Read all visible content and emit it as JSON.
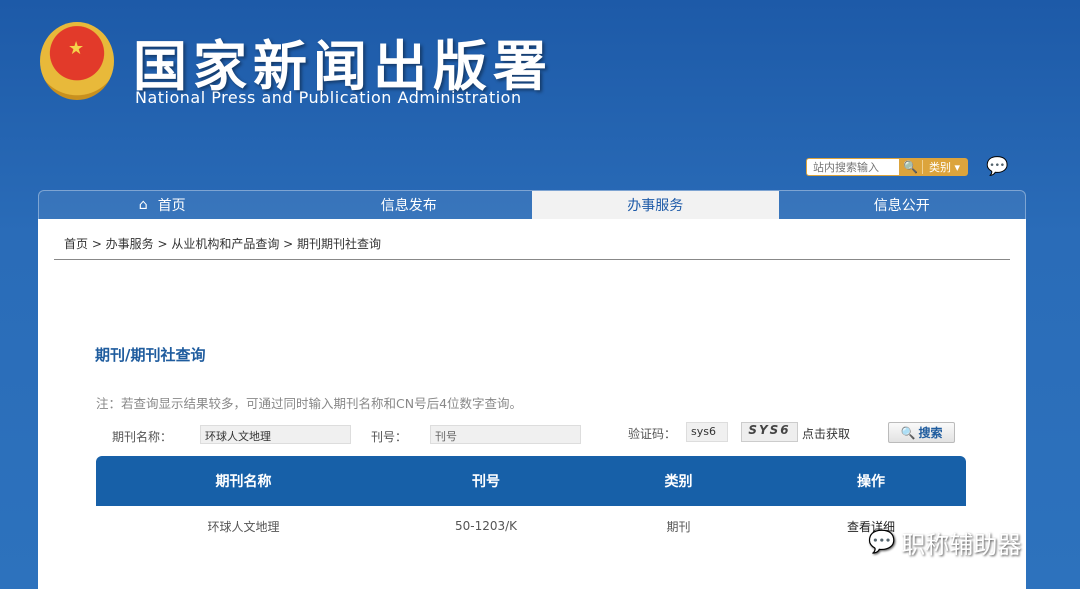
{
  "header": {
    "title_cn": "国家新闻出版署",
    "title_en": "National  Press and Publication Administration",
    "search_placeholder": "站内搜索输入",
    "category": "类别"
  },
  "nav": [
    {
      "label": "首页"
    },
    {
      "label": "信息发布"
    },
    {
      "label": "办事服务"
    },
    {
      "label": "信息公开"
    }
  ],
  "breadcrumb": "首页 > 办事服务 > 从业机构和产品查询 > 期刊期刊社查询",
  "page_title": "期刊/期刊社查询",
  "note": "注：若查询显示结果较多，可通过同时输入期刊名称和CN号后4位数字查询。",
  "form": {
    "name_label": "期刊名称：",
    "name_value": "环球人文地理",
    "cn_label": "刊号：",
    "cn_placeholder": "刊号",
    "captcha_label": "验证码：",
    "captcha_value": "sys6",
    "captcha_image": "SYS6",
    "captcha_refresh": "点击获取",
    "search_button": "搜索"
  },
  "table": {
    "headers": [
      "期刊名称",
      "刊号",
      "类别",
      "操作"
    ],
    "rows": [
      {
        "name": "环球人文地理",
        "cn": "50-1203/K",
        "type": "期刊",
        "action": "查看详细"
      }
    ]
  },
  "watermark": "职称辅助器"
}
